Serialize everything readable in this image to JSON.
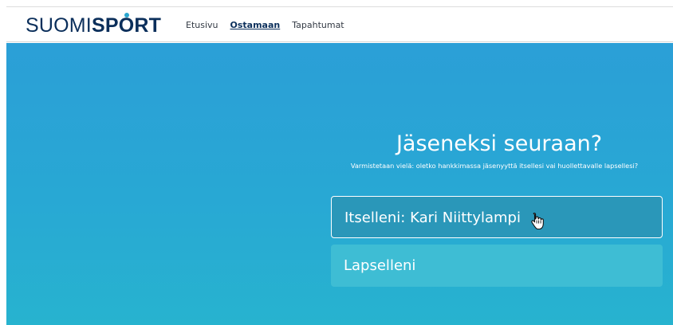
{
  "brand": {
    "logo_light": "SUOMI",
    "logo_bold_pre": "SP",
    "logo_bold_o": "O",
    "logo_bold_post": "RT"
  },
  "nav": {
    "items": [
      "Etusivu",
      "Ostamaan",
      "Tapahtumat"
    ],
    "active": "Ostamaan"
  },
  "hero": {
    "title": "Jäseneksi seuraan?",
    "subtitle": "Varmistetaan vielä: oletko hankkimassa jäsenyyttä itsellesi vai huollettavalle lapsellesi?",
    "options": [
      "Itselleni: Kari Niittylampi",
      "Lapselleni"
    ]
  },
  "colors": {
    "brand_navy": "#0b2f5b",
    "accent_dot": "#2aa6cf",
    "hero_top": "#2b9fd7",
    "hero_bottom": "#27b3cf",
    "option_selected": "#2a97b9",
    "option_default": "#3ebdd4"
  },
  "icons": {
    "cursor": "hand-pointer-icon"
  }
}
